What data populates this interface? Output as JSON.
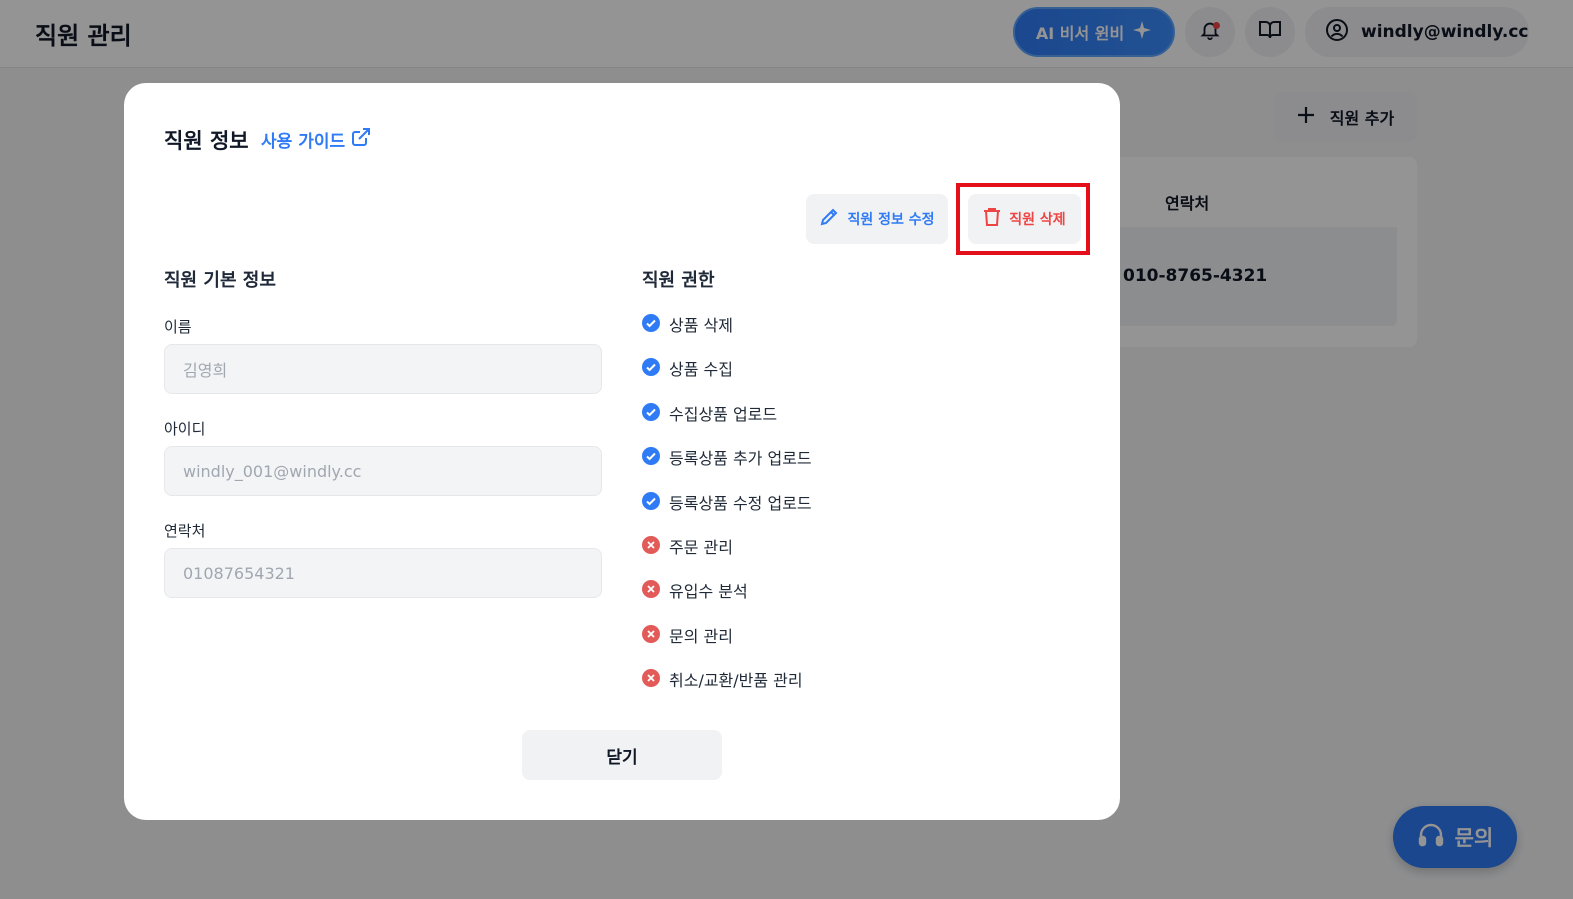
{
  "header": {
    "page_title": "직원 관리",
    "ai_button_label": "AI 비서 윈비",
    "account_email": "windly@windly.cc"
  },
  "background": {
    "add_staff_label": "직원 추가",
    "column_header_contact": "연락처",
    "row_contact": "010-8765-4321",
    "inquiry_label": "문의"
  },
  "modal": {
    "title": "직원 정보",
    "guide_link": "사용 가이드",
    "edit_button": "직원 정보 수정",
    "delete_button": "직원 삭제",
    "basic_section_title": "직원 기본 정보",
    "fields": [
      {
        "label": "이름",
        "value": "김영희"
      },
      {
        "label": "아이디",
        "value": "windly_001@windly.cc"
      },
      {
        "label": "연락처",
        "value": "01087654321"
      }
    ],
    "permission_section_title": "직원 권한",
    "permissions": [
      {
        "label": "상품 삭제",
        "granted": true
      },
      {
        "label": "상품 수집",
        "granted": true
      },
      {
        "label": "수집상품 업로드",
        "granted": true
      },
      {
        "label": "등록상품 추가 업로드",
        "granted": true
      },
      {
        "label": "등록상품 수정 업로드",
        "granted": true
      },
      {
        "label": "주문 관리",
        "granted": false
      },
      {
        "label": "유입수 분석",
        "granted": false
      },
      {
        "label": "문의 관리",
        "granted": false
      },
      {
        "label": "취소/교환/반품 관리",
        "granted": false
      }
    ],
    "close_button": "닫기"
  },
  "colors": {
    "accent": "#2f7bf5",
    "danger": "#ef4444",
    "highlight": "#e3101b"
  }
}
